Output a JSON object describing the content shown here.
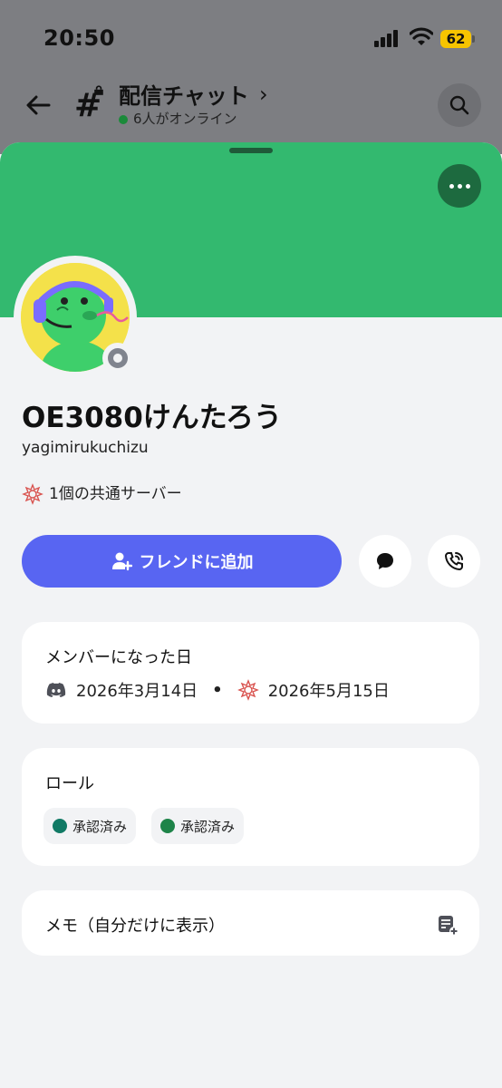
{
  "status_bar": {
    "time": "20:50",
    "battery": "62"
  },
  "nav": {
    "channel_name": "配信チャット",
    "online_status": "6人がオンライン"
  },
  "profile": {
    "display_name": "OE3080けんたろう",
    "username": "yagimirukuchizu",
    "mutual_servers": "1個の共通サーバー",
    "add_friend_label": "フレンドに追加"
  },
  "member_since": {
    "title": "メンバーになった日",
    "discord_date": "2026年3月14日",
    "separator": "•",
    "server_date": "2026年5月15日"
  },
  "roles": {
    "title": "ロール",
    "items": [
      {
        "label": "承認済み",
        "color": "#117a65"
      },
      {
        "label": "承認済み",
        "color": "#1e8449"
      }
    ]
  },
  "note": {
    "label": "メモ（自分だけに表示）"
  },
  "colors": {
    "banner": "#33b96f",
    "accent": "#5865f2",
    "status_offline": "#80848e"
  }
}
